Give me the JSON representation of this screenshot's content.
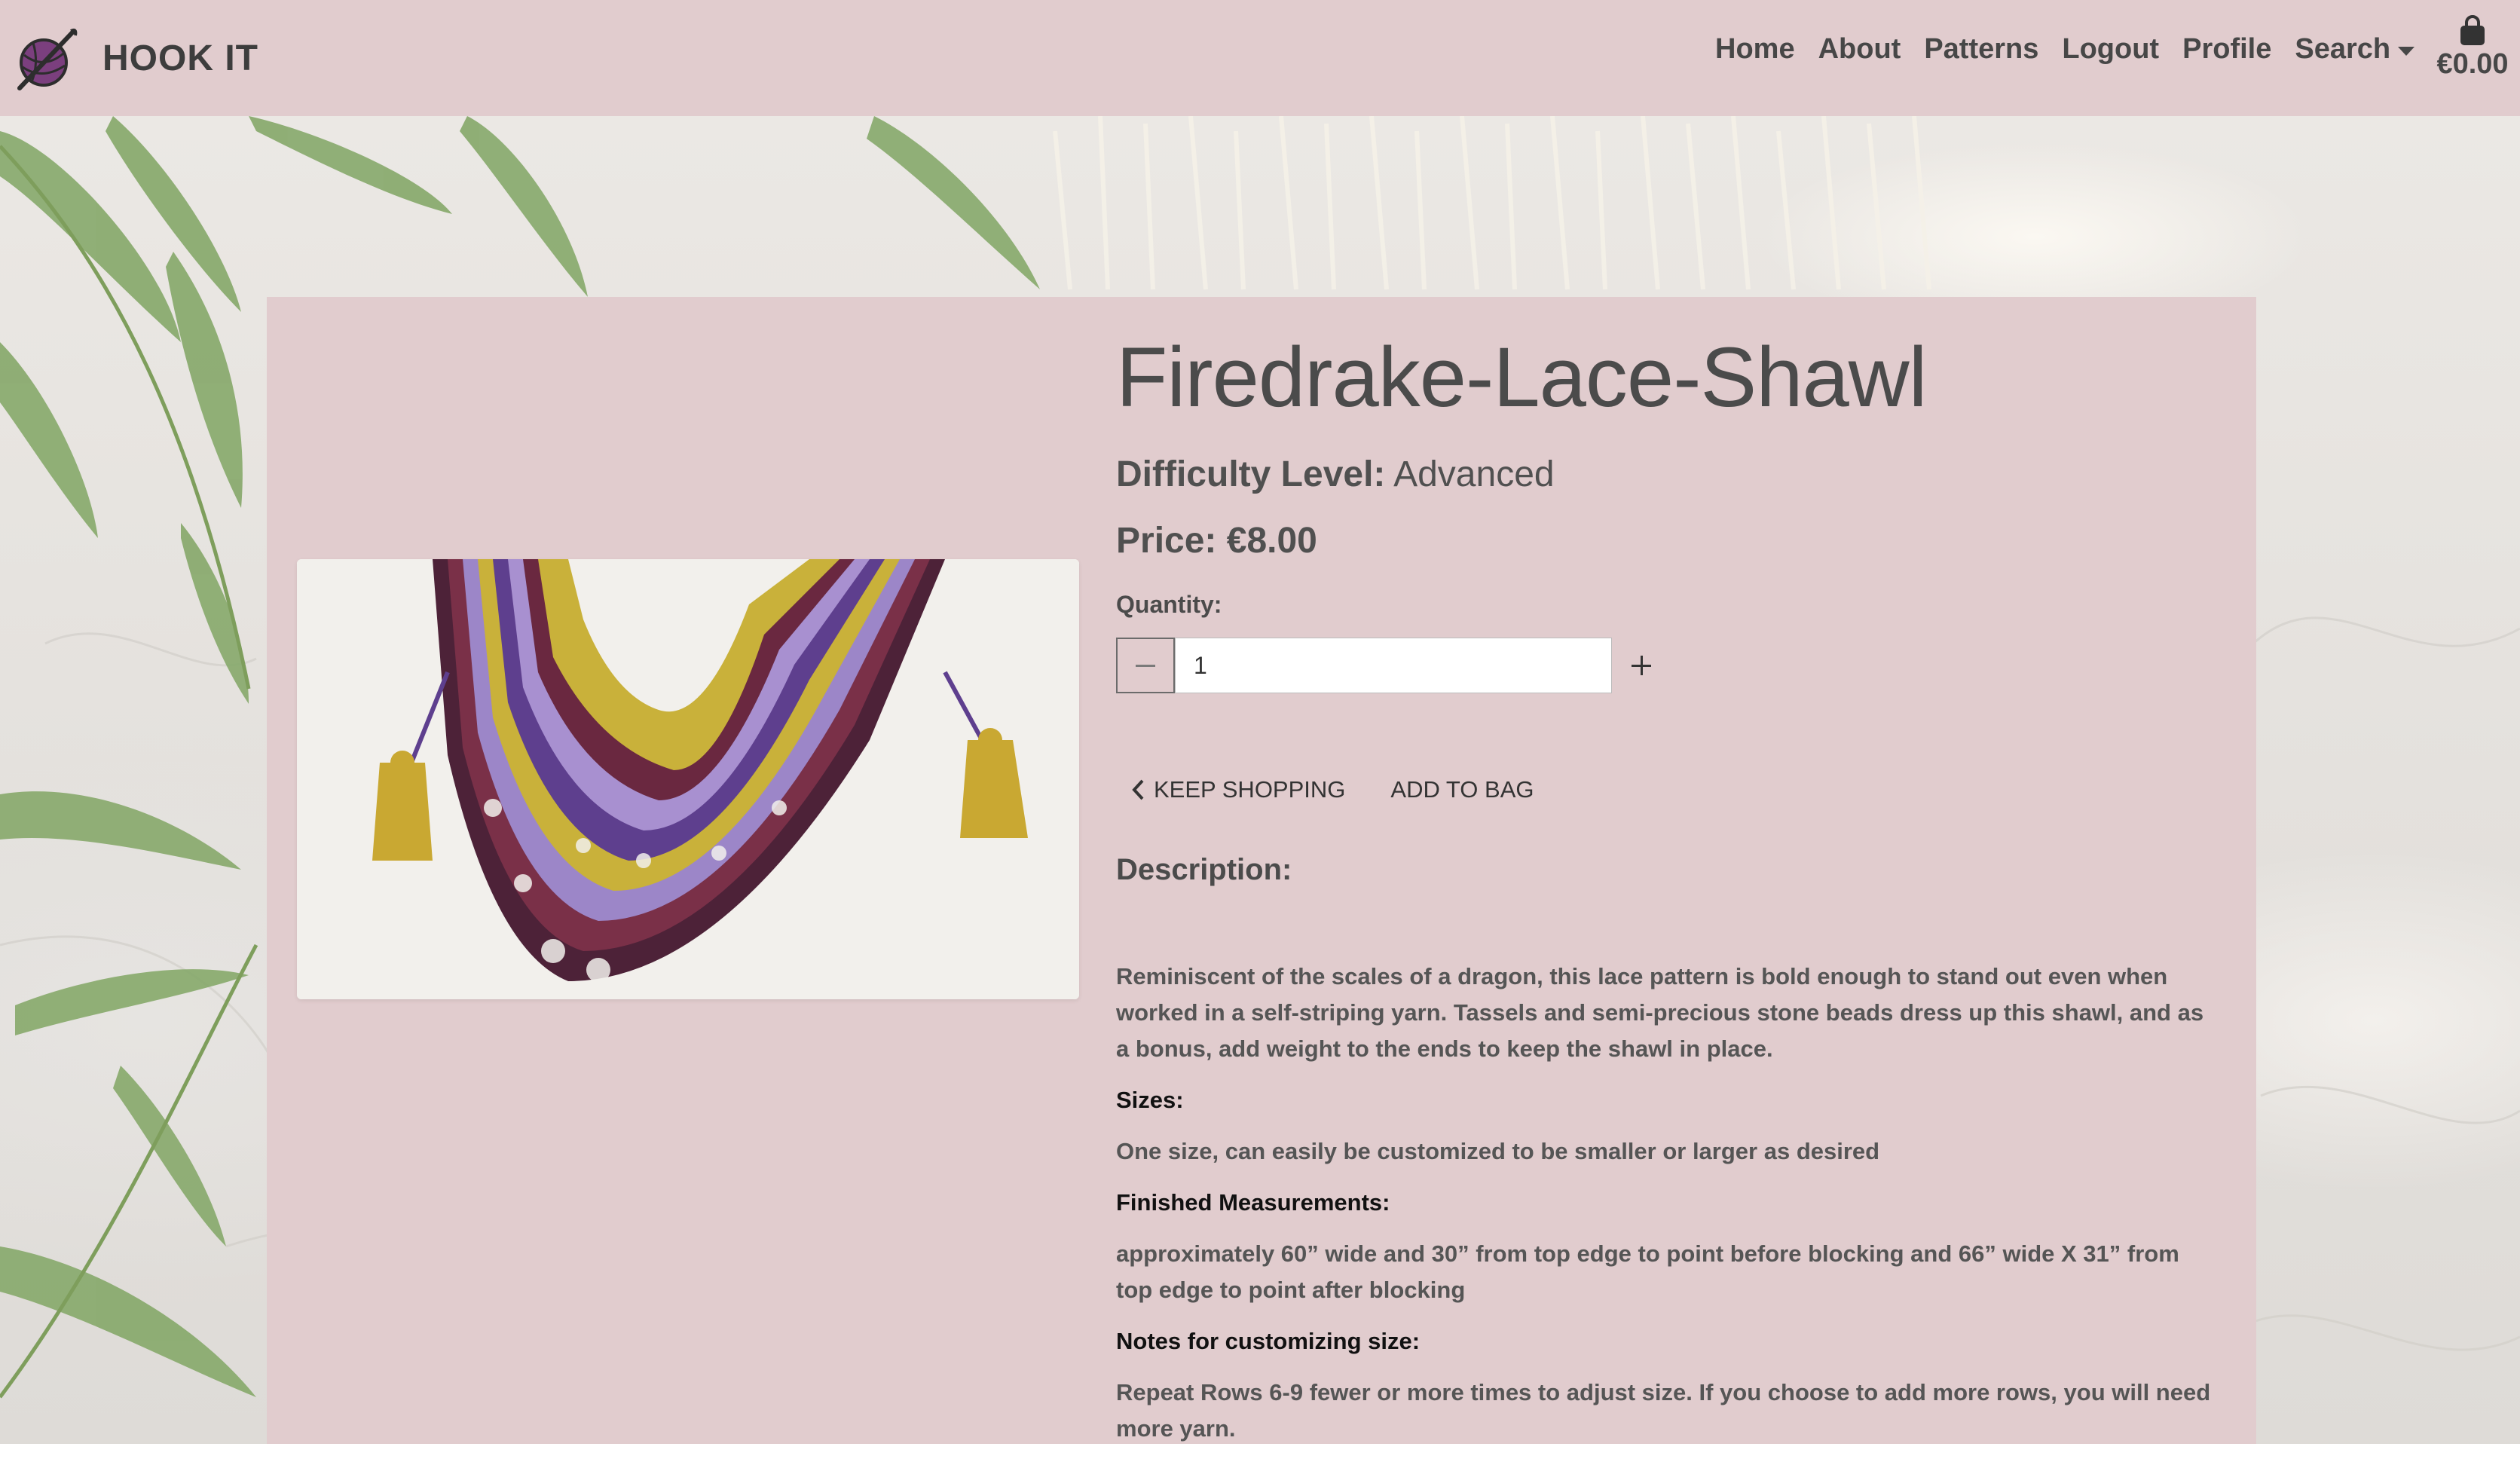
{
  "brand": {
    "name": "HOOK IT",
    "logo_icon": "yarn-hook-icon"
  },
  "nav": {
    "links": [
      "Home",
      "About",
      "Patterns",
      "Logout",
      "Profile"
    ],
    "search_label": "Search",
    "bag_total": "€0.00"
  },
  "product": {
    "title": "Firedrake-Lace-Shawl",
    "difficulty_label": "Difficulty Level:",
    "difficulty_value": "Advanced",
    "price": "Price: €8.00",
    "image_alt": "Firedrake lace shawl crocheted in yellow, purple and burgundy",
    "quantity_label": "Quantity:",
    "quantity_value": "1",
    "keep_shopping": "KEEP SHOPPING",
    "add_to_bag": "ADD TO BAG",
    "description_heading": "Description:",
    "description": "Reminiscent of the scales of a dragon, this lace pattern is bold enough to stand out even when worked in a self-striping yarn. Tassels and semi-precious stone beads dress up this shawl, and as a bonus, add weight to the ends to keep the shawl in place.",
    "sizes_heading": "Sizes:",
    "sizes_text": "One size, can easily be customized to be smaller or larger as desired",
    "measurements_heading": "Finished Measurements:",
    "measurements_text": "approximately 60” wide and 30” from top edge to point before blocking and 66” wide X 31” from top edge to point after blocking",
    "notes_heading": "Notes for customizing size:",
    "notes_text": "Repeat Rows 6-9 fewer or more times to adjust size. If you choose to add more rows, you will need more yarn."
  },
  "colors": {
    "navbar_bg": "#e1ccce",
    "card_bg": "#e1ccce",
    "text_dark": "#474747",
    "yarn_yellow": "#c9b13a",
    "yarn_purple": "#6a4f9a",
    "yarn_burgundy": "#7a2a3c"
  }
}
